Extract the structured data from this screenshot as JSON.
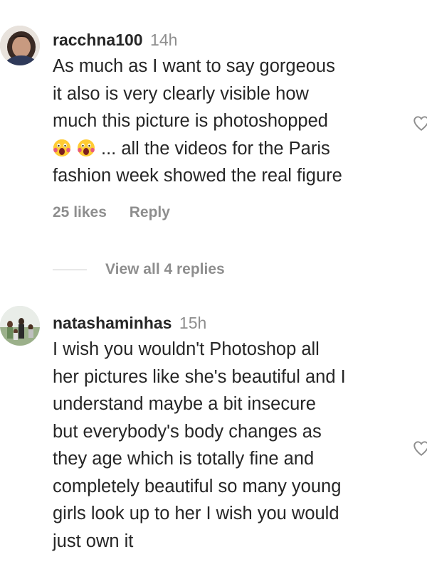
{
  "comments": [
    {
      "username": "racchna100",
      "time": "14h",
      "text_lines": [
        "As much as I want to say gorgeous",
        "it also is very clearly visible how",
        "much this picture is photoshopped",
        "... all the videos for the Paris",
        "fashion week showed the real figure"
      ],
      "emojis": [
        "face-screaming-emoji",
        "face-screaming-emoji"
      ],
      "likes": "25 likes",
      "reply_label": "Reply",
      "view_replies": "View all 4 replies"
    },
    {
      "username": "natashaminhas",
      "time": "15h",
      "text_lines": [
        "I wish you wouldn't Photoshop all",
        "her pictures like she's beautiful and I",
        "understand maybe a bit insecure",
        "but everybody's body changes as",
        "they age which is totally fine and",
        "completely beautiful so many young",
        "girls look up to her I wish you would",
        "just own it"
      ]
    }
  ],
  "icons": {
    "like": "heart-outline-icon"
  },
  "colors": {
    "text": "#262626",
    "secondary": "#8e8e8e",
    "divider": "#c7c7c7"
  }
}
